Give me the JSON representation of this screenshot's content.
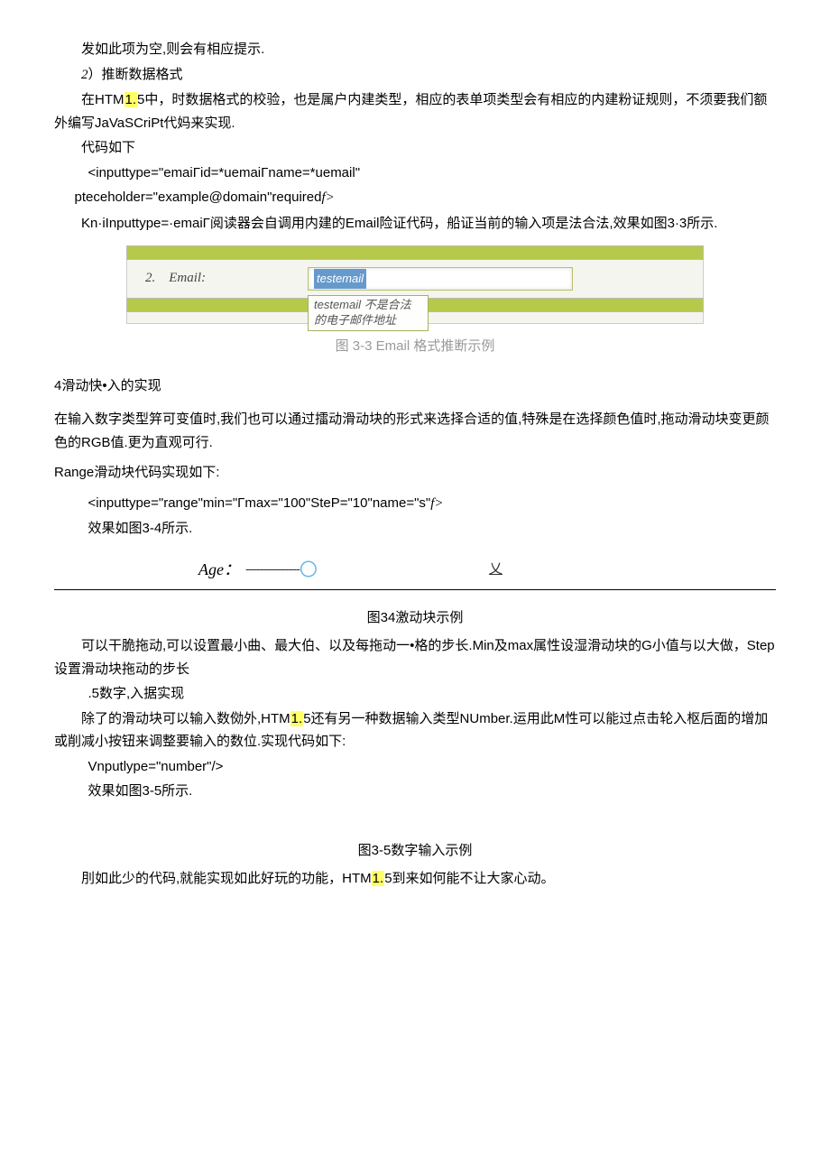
{
  "p1": "发如此项为空,则会有相应提示.",
  "p2_prefix": "2",
  "p2_rest": "）推断数据格式",
  "p3_a": "在HTM",
  "p3_mark": "1.",
  "p3_b": "5中，时数据格式的校验，也是属户内建类型，相应的表单项类型会有相应的内建粉证规则，不须要我们额外编写JaVaSCriPt代妈来实现.",
  "p4": "代码如下",
  "code1": "<inputtype=\"emaiΓid=*uemaiΓname=*uemail\"",
  "code2_a": "pteceholder=\"example@domain\"required",
  "code2_b": "f>",
  "p5": "Kn·iInputtype=·emaiΓ阅读器会自调用内建的Email险证代码，船证当前的输入项是法合法,效果如图3·3所示.",
  "fig1_num": "2.",
  "fig1_label": "Email:",
  "fig1_val": "testemail",
  "fig1_tip": "testemail 不是合法的电子邮件地址",
  "fig1_cap": "图 3-3   Email 格式推断示例",
  "h4": "4滑动快•入的实现",
  "p6": "在输入数字类型笄可变值时,我们也可以通过擂动滑动块的形式来选择合适的值,特殊是在选择颜色值时,拖动滑动块变更颜色的RGB值.更为直观可行.",
  "p7": "Range滑动块代码实现如下:",
  "code3_a": "<inputtype=\"range\"min=\"Γmax=\"100\"SteP=\"10\"name=\"s\"",
  "code3_b": "f>",
  "p8": "效果如图3-4所示.",
  "age_label": "Age：",
  "age_track": "---------------",
  "age_thumb": "〇",
  "age_x": "乂",
  "fig2_cap": "图34激动块示例",
  "p9": "可以干脆拖动,可以设置最小曲、最大伯、以及每拖动一•格的步长.Min及max属性设湿滑动块的G小值与以大做，Step设置滑动块拖动的步长",
  "p10": ".5数字,入据实现",
  "p11_a": "除了的滑动块可以输入数俲外,HTM",
  "p11_mark": "1.",
  "p11_b": "5还有另一种数据输入类型NUmber.运用此M性可以能过点击轮入枢后面的增加或削减小按钮来调整要输入的数位.实现代码如下:",
  "code4": "Vnputlype=\"number\"/>",
  "p12": "效果如图3-5所示.",
  "fig3_cap": "图3-5数字输入示例",
  "p13_a": "刖如此少的代码,就能实现如此好玩的功能，HTM",
  "p13_mark": "1.",
  "p13_b": "5到来如何能不让大家心动。"
}
